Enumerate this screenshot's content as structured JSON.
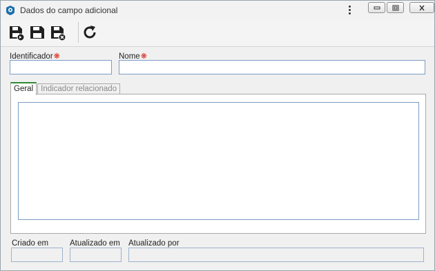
{
  "window": {
    "title": "Dados do campo adicional",
    "minimize_icon": "minimize-icon",
    "maximize_icon": "maximize-icon",
    "close_icon": "close-icon"
  },
  "toolbar": {
    "buttons": [
      {
        "icon": "save-new-icon"
      },
      {
        "icon": "save-icon"
      },
      {
        "icon": "save-close-icon"
      },
      {
        "icon": "refresh-icon"
      }
    ]
  },
  "form": {
    "identifier_label": "Identificador",
    "identifier_value": "",
    "name_label": "Nome",
    "name_value": "",
    "required_marker": "❋"
  },
  "tabs": [
    {
      "label": "Geral",
      "active": true
    },
    {
      "label": "Indicador relacionado",
      "active": false
    }
  ],
  "general": {
    "description_value": ""
  },
  "footer": {
    "created_label": "Criado em",
    "created_value": "",
    "updated_label": "Atualizado em",
    "updated_value": "",
    "updated_by_label": "Atualizado por",
    "updated_by_value": ""
  },
  "colors": {
    "accent_tab": "#2f8a2f",
    "required": "#d9261c",
    "input_border": "#7a9cc4"
  }
}
